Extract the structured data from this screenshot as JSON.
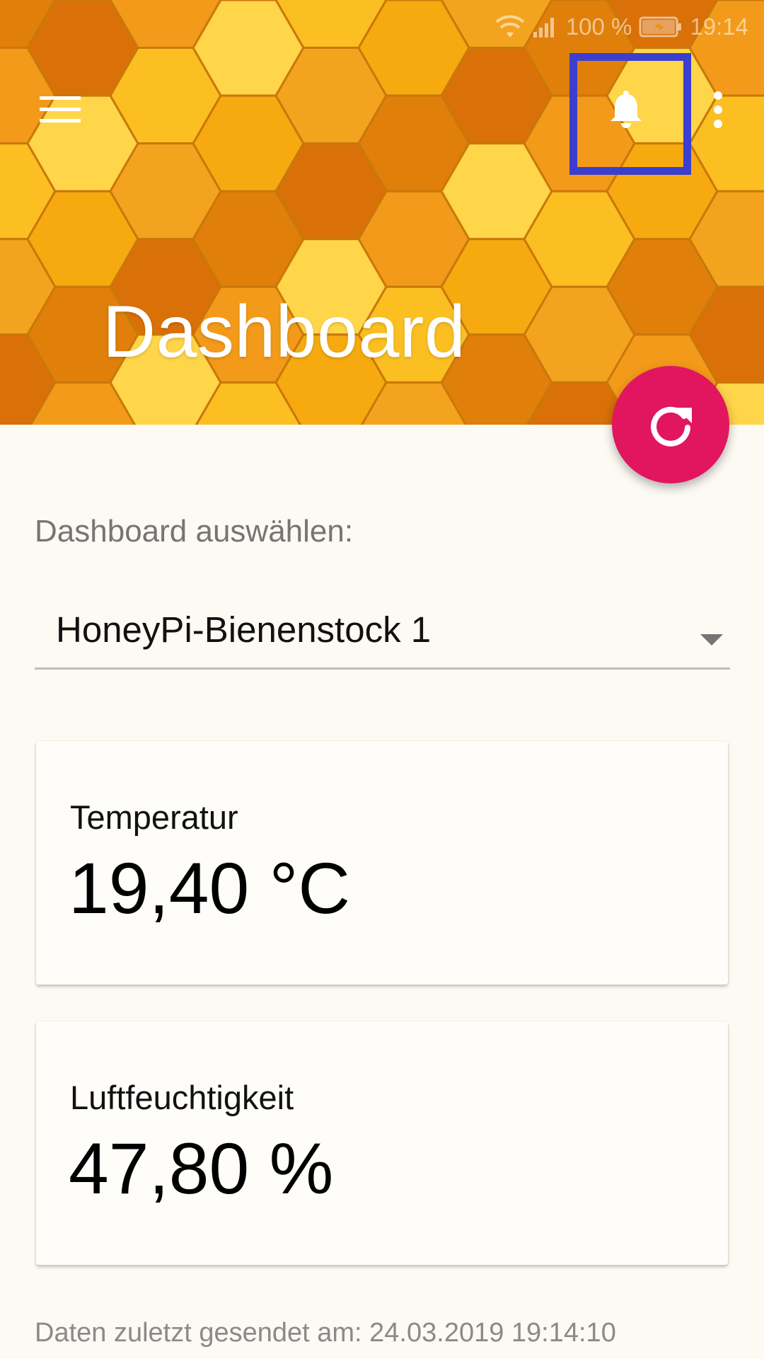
{
  "status_bar": {
    "battery_percent": "100 %",
    "time": "19:14",
    "icons": [
      "wifi-icon",
      "signal-icon",
      "battery-charging-icon"
    ]
  },
  "toolbar": {
    "menu_icon": "hamburger-menu-icon",
    "notification_icon": "bell-icon",
    "overflow_icon": "more-vert-icon"
  },
  "header": {
    "title": "Dashboard",
    "background": "honeycomb-pattern"
  },
  "fab": {
    "icon": "refresh-icon",
    "color": "#e2155f"
  },
  "dashboard_select": {
    "label": "Dashboard auswählen:",
    "selected": "HoneyPi-Bienenstock 1"
  },
  "cards": [
    {
      "label": "Temperatur",
      "value": "19,40 °C"
    },
    {
      "label": "Luftfeuchtigkeit",
      "value": "47,80 %"
    }
  ],
  "footer": {
    "last_sent": "Daten zuletzt gesendet am: 24.03.2019 19:14:10"
  },
  "colors": {
    "accent": "#e2155f",
    "header_orange": "#e9920f",
    "highlight_box": "#3b3ecf"
  }
}
